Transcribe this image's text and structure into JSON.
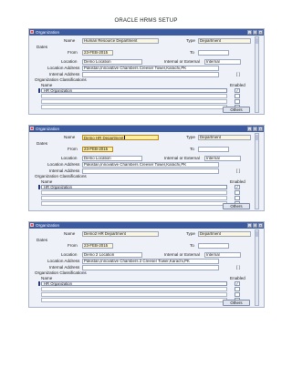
{
  "document": {
    "title": "ORACLE HRMS SETUP"
  },
  "labels": {
    "window_title": "Organization",
    "name": "Name",
    "type": "Type",
    "dates": "Dates",
    "from": "From",
    "to": "To",
    "location": "Location",
    "internal_external": "Internal or External",
    "location_address": "Location Address",
    "internal_address": "Internal Address",
    "classifications": "Organization Classifications",
    "col_name": "Name",
    "col_enabled": "Enabled",
    "others_button": "Others",
    "lov": "[  ]",
    "checkmark": "✓",
    "win_min": "-",
    "win_max": "□",
    "win_close": "×"
  },
  "screenshots": [
    {
      "name": "Human Resource Department",
      "type": "Department",
      "from": "23-FEB-2015",
      "to": "",
      "location": "Demo Location",
      "internal_external": "Internal",
      "location_address": "Pakistan,Innovative Chambers Creeser Tower,Karachi,PK",
      "internal_address": "",
      "classification": "HR Organization",
      "enabled": true,
      "name_focused": false
    },
    {
      "name": "Demo HR Department",
      "type": "Department",
      "from": "23-FEB-2015",
      "to": "",
      "location": "Demo Location",
      "internal_external": "Internal",
      "location_address": "Pakistan,Innovative Chambers Creeser Tower,Karachi,PK",
      "internal_address": "",
      "classification": "HR Organization",
      "enabled": true,
      "name_focused": true
    },
    {
      "name": "Demo2 HR Department",
      "type": "Department",
      "from": "23-FEB-2015",
      "to": "",
      "location": "Demo 2 Location",
      "internal_external": "Internal",
      "location_address": "Pakistan,Innovative Chambers 2 Creeser Tower,Karachi,PK",
      "internal_address": "",
      "classification": "HR Organization",
      "enabled": true,
      "name_focused": false
    }
  ]
}
